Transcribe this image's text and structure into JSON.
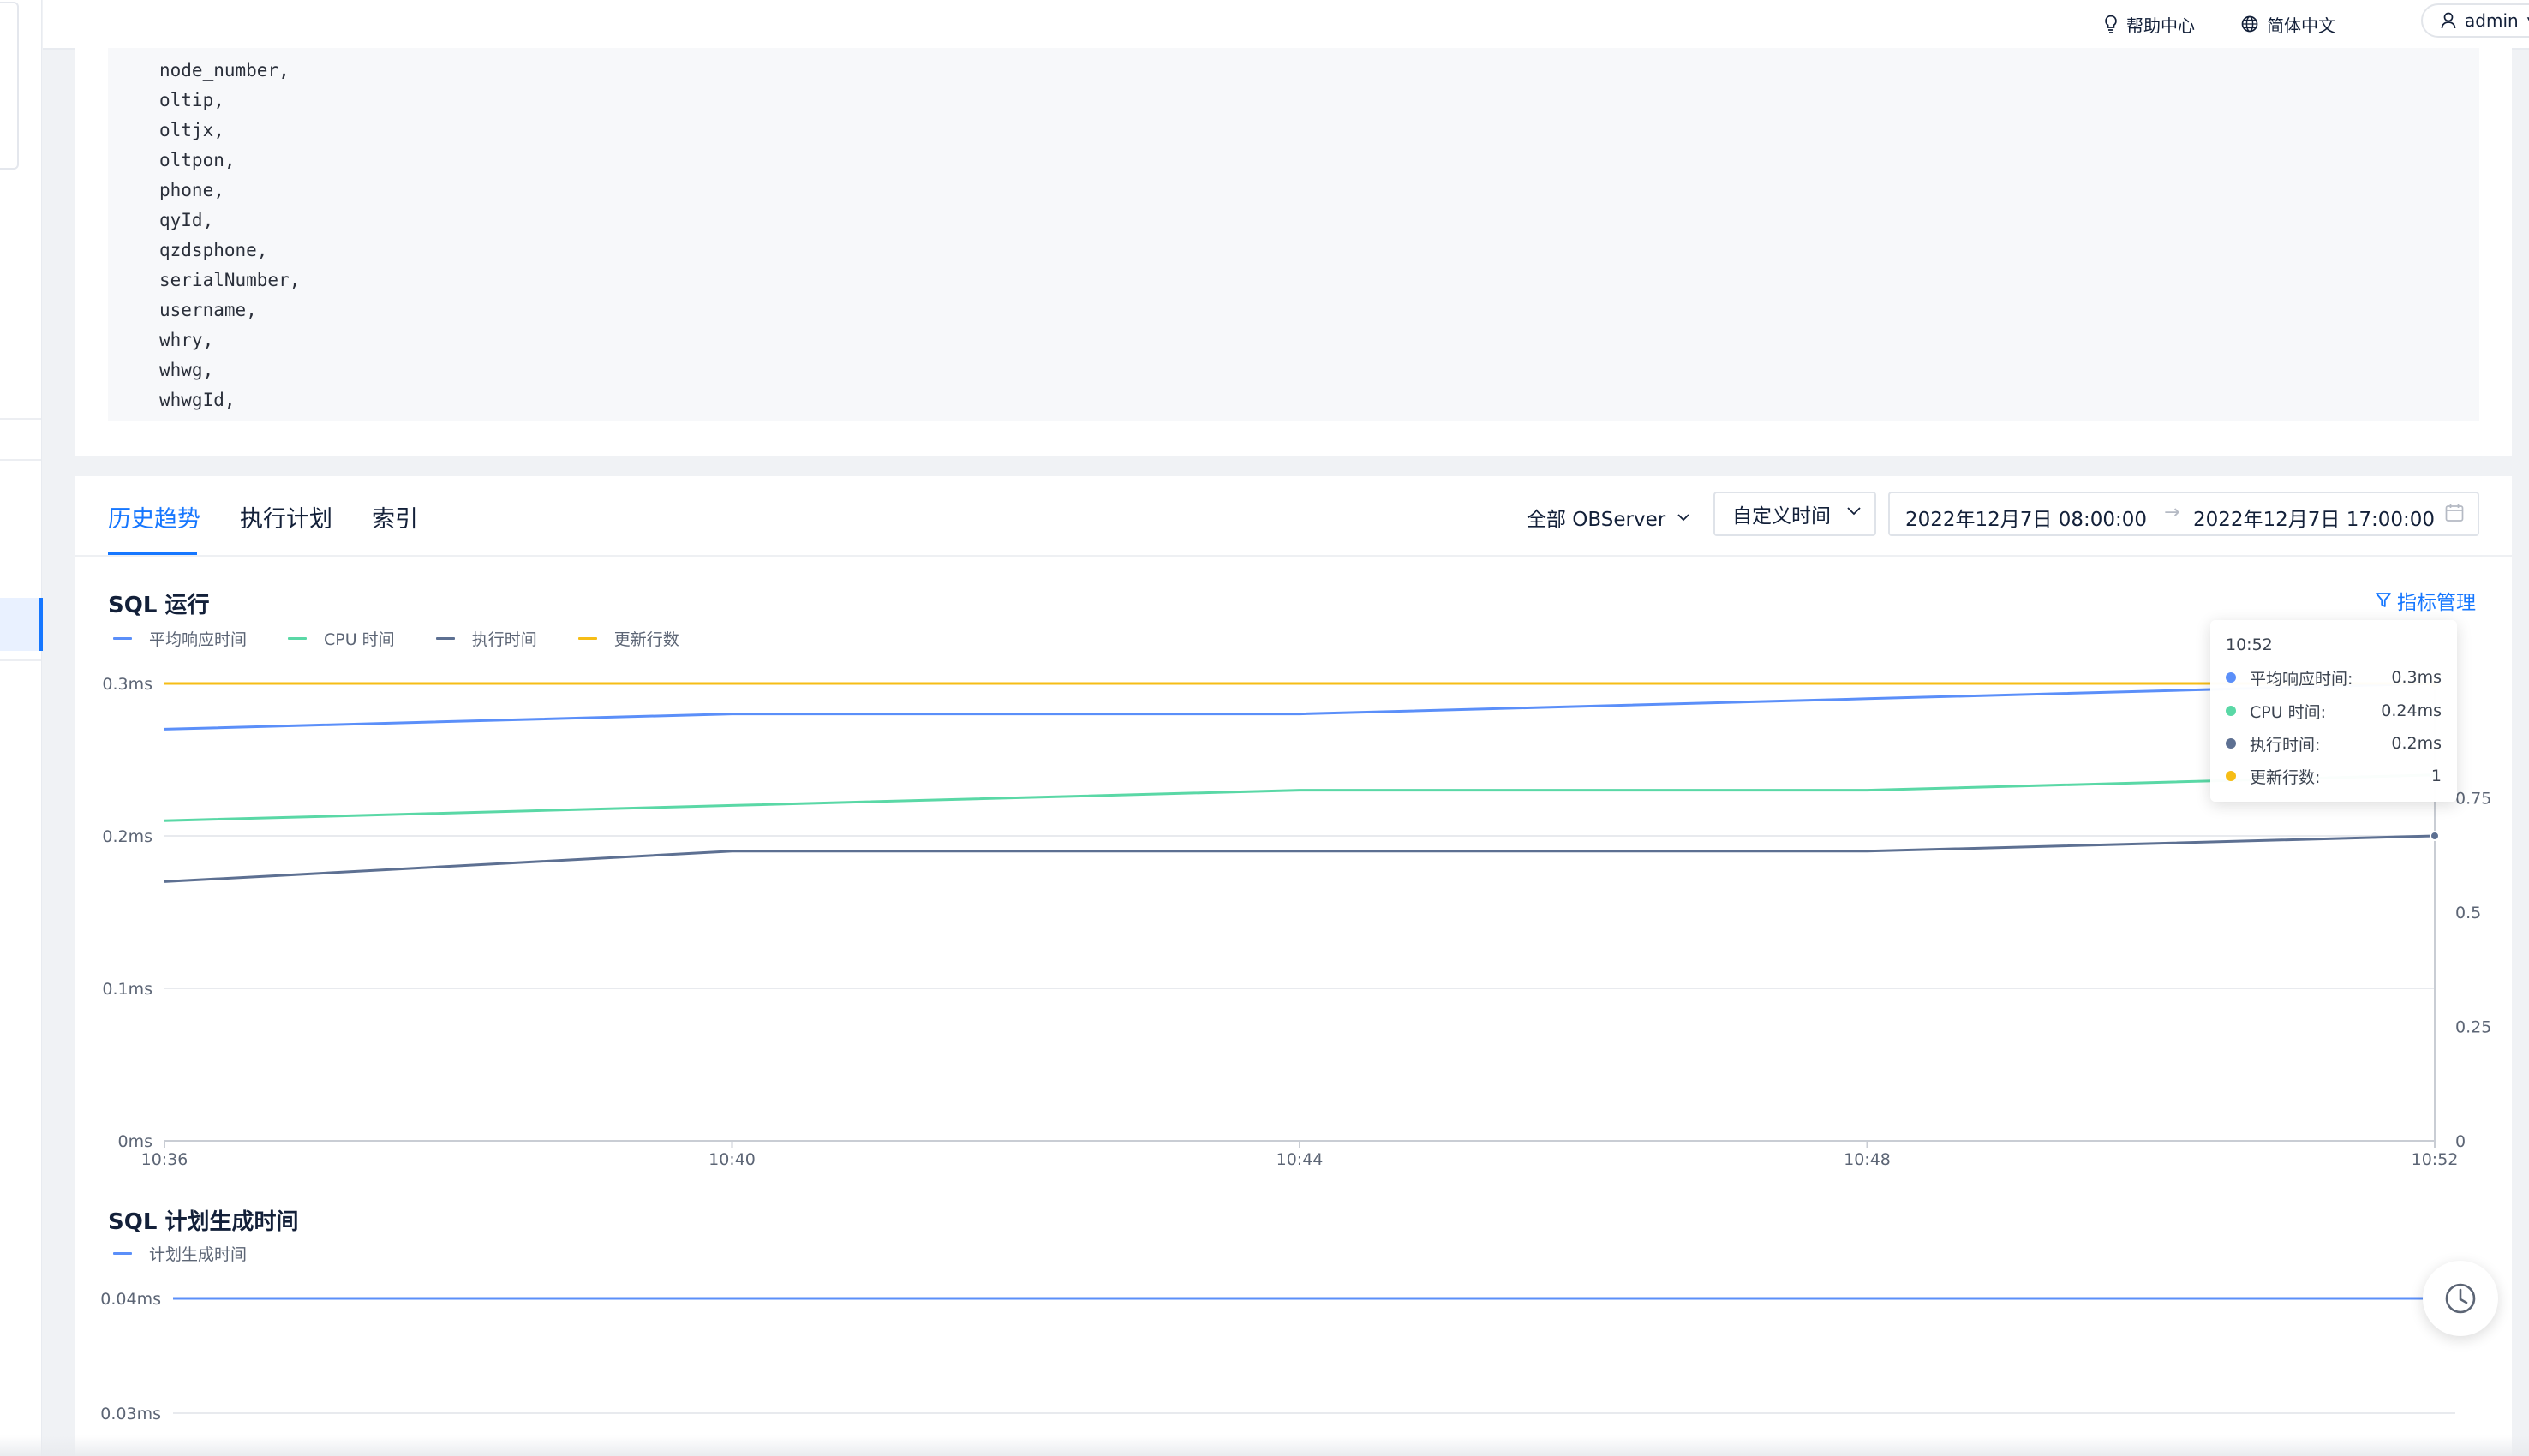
{
  "header": {
    "help": "帮助中心",
    "language": "简体中文",
    "user": "admin"
  },
  "code": {
    "lines": [
      "node_number,",
      "oltip,",
      "oltjx,",
      "oltpon,",
      "phone,",
      "qyId,",
      "qzdsphone,",
      "serialNumber,",
      "username,",
      "whry,",
      "whwg,",
      "whwgId,"
    ]
  },
  "tabs": [
    {
      "label": "历史趋势",
      "active": true
    },
    {
      "label": "执行计划",
      "active": false
    },
    {
      "label": "索引",
      "active": false
    }
  ],
  "filters": {
    "server": "全部 OBServer",
    "time_mode": "自定义时间",
    "start": "2022年12月7日 08:00:00",
    "end": "2022年12月7日 17:00:00"
  },
  "metric_management": "指标管理",
  "colors": {
    "accent": "#1677ff",
    "avg_response": "#5b8ff9",
    "cpu": "#5ad8a6",
    "exec": "#5d7092",
    "rows": "#f6bd16"
  },
  "chart_data": [
    {
      "type": "line",
      "title": "SQL 运行",
      "x": [
        "10:36",
        "10:40",
        "10:44",
        "10:48",
        "10:52"
      ],
      "xlabels": [
        "10:36",
        "10:40",
        "10:44",
        "10:48",
        "10:52"
      ],
      "y_ticks": [
        "0ms",
        "0.1ms",
        "0.2ms",
        "0.3ms"
      ],
      "ylim": [
        0,
        0.3
      ],
      "y2_ticks": [
        "0",
        "0.25",
        "0.5",
        "0.75"
      ],
      "y2lim": [
        0,
        1
      ],
      "grid": true,
      "legend_position": "top-left",
      "series": [
        {
          "name": "平均响应时间",
          "color": "#5b8ff9",
          "axis": "left",
          "values": [
            0.27,
            0.28,
            0.28,
            0.29,
            0.3
          ]
        },
        {
          "name": "CPU 时间",
          "color": "#5ad8a6",
          "axis": "left",
          "values": [
            0.21,
            0.22,
            0.23,
            0.23,
            0.24
          ]
        },
        {
          "name": "执行时间",
          "color": "#5d7092",
          "axis": "left",
          "values": [
            0.17,
            0.19,
            0.19,
            0.19,
            0.2
          ]
        },
        {
          "name": "更新行数",
          "color": "#f6bd16",
          "axis": "right",
          "values": [
            1,
            1,
            1,
            1,
            1
          ]
        }
      ],
      "tooltip": {
        "x": "10:52",
        "rows": [
          {
            "name": "平均响应时间:",
            "value": "0.3ms",
            "color": "#5b8ff9"
          },
          {
            "name": "CPU 时间:",
            "value": "0.24ms",
            "color": "#5ad8a6"
          },
          {
            "name": "执行时间:",
            "value": "0.2ms",
            "color": "#5d7092"
          },
          {
            "name": "更新行数:",
            "value": "1",
            "color": "#f6bd16"
          }
        ]
      }
    },
    {
      "type": "line",
      "title": "SQL 计划生成时间",
      "y_ticks": [
        "0.03ms",
        "0.04ms"
      ],
      "legend_position": "top-left",
      "grid": true,
      "series": [
        {
          "name": "计划生成时间",
          "color": "#5b8ff9",
          "values": [
            0.04,
            0.04,
            0.04,
            0.04,
            0.04
          ]
        }
      ]
    }
  ]
}
